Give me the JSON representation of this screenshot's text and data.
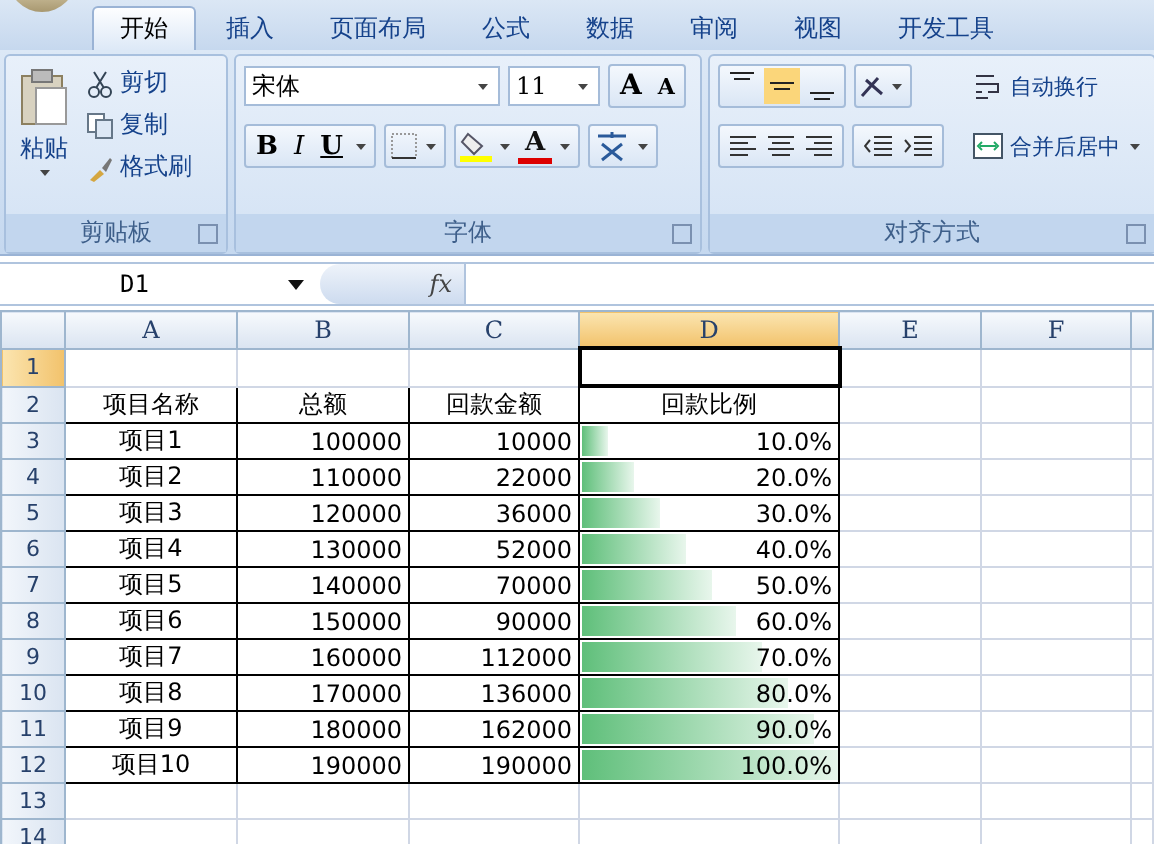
{
  "tabs": [
    {
      "label": "开始",
      "selected": true
    },
    {
      "label": "插入",
      "selected": false
    },
    {
      "label": "页面布局",
      "selected": false
    },
    {
      "label": "公式",
      "selected": false
    },
    {
      "label": "数据",
      "selected": false
    },
    {
      "label": "审阅",
      "selected": false
    },
    {
      "label": "视图",
      "selected": false
    },
    {
      "label": "开发工具",
      "selected": false
    }
  ],
  "clipboard": {
    "paste": "粘贴",
    "items": [
      {
        "kind": "cut",
        "label": "剪切"
      },
      {
        "kind": "copy",
        "label": "复制"
      },
      {
        "kind": "painter",
        "label": "格式刷"
      }
    ],
    "title": "剪贴板"
  },
  "font": {
    "font_name": "宋体",
    "font_size": "11",
    "grow": "A",
    "shrink": "A",
    "bold": "B",
    "italic": "I",
    "underline": "U",
    "font_color": "A",
    "title": "字体"
  },
  "alignment": {
    "vertical": [
      {
        "kind": "top",
        "selected": false
      },
      {
        "kind": "middle",
        "selected": true
      },
      {
        "kind": "bottom",
        "selected": false
      }
    ],
    "wrap": "自动换行",
    "merge": "合并后居中",
    "title": "对齐方式"
  },
  "name_box": "D1",
  "function_button": "fx",
  "columns": [
    {
      "label": "A",
      "selected": false
    },
    {
      "label": "B",
      "selected": false
    },
    {
      "label": "C",
      "selected": false
    },
    {
      "label": "D",
      "selected": true
    },
    {
      "label": "E",
      "selected": false
    },
    {
      "label": "F",
      "selected": false
    }
  ],
  "rows": [
    {
      "number": "1",
      "selected": true,
      "cells": []
    },
    {
      "number": "2",
      "selected": false,
      "cells": [
        "项目名称",
        "总额",
        "回款金额",
        "回款比例"
      ]
    },
    {
      "number": "3",
      "selected": false,
      "cells": [
        "项目1",
        "100000",
        "10000",
        "10.0%"
      ],
      "level": 0.1
    },
    {
      "number": "4",
      "selected": false,
      "cells": [
        "项目2",
        "110000",
        "22000",
        "20.0%"
      ],
      "level": 0.2
    },
    {
      "number": "5",
      "selected": false,
      "cells": [
        "项目3",
        "120000",
        "36000",
        "30.0%"
      ],
      "level": 0.3
    },
    {
      "number": "6",
      "selected": false,
      "cells": [
        "项目4",
        "130000",
        "52000",
        "40.0%"
      ],
      "level": 0.4
    },
    {
      "number": "7",
      "selected": false,
      "cells": [
        "项目5",
        "140000",
        "70000",
        "50.0%"
      ],
      "level": 0.5
    },
    {
      "number": "8",
      "selected": false,
      "cells": [
        "项目6",
        "150000",
        "90000",
        "60.0%"
      ],
      "level": 0.6
    },
    {
      "number": "9",
      "selected": false,
      "cells": [
        "项目7",
        "160000",
        "112000",
        "70.0%"
      ],
      "level": 0.7
    },
    {
      "number": "10",
      "selected": false,
      "cells": [
        "项目8",
        "170000",
        "136000",
        "80.0%"
      ],
      "level": 0.8
    },
    {
      "number": "11",
      "selected": false,
      "cells": [
        "项目9",
        "180000",
        "162000",
        "90.0%"
      ],
      "level": 0.9
    },
    {
      "number": "12",
      "selected": false,
      "cells": [
        "项目10",
        "190000",
        "190000",
        "100.0%"
      ],
      "level": 1.0
    },
    {
      "number": "13",
      "selected": false,
      "cells": []
    },
    {
      "number": "14",
      "selected": false,
      "cells": []
    }
  ]
}
